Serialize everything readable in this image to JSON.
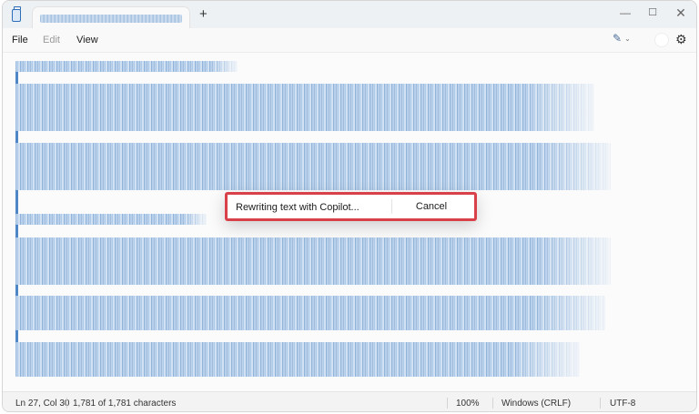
{
  "menu": {
    "file": "File",
    "edit": "Edit",
    "view": "View"
  },
  "titlebar": {
    "new_tab": "+",
    "minimize": "—",
    "maximize": "☐",
    "close": "✕"
  },
  "toolbar": {
    "copilot_icon": "✎",
    "copilot_chevron": "⌄",
    "settings_icon": "⚙"
  },
  "dialog": {
    "status": "Rewriting text with Copilot...",
    "cancel": "Cancel"
  },
  "status": {
    "position": "Ln 27, Col 30",
    "characters": "1,781 of 1,781 characters",
    "zoom": "100%",
    "line_ending": "Windows (CRLF)",
    "encoding": "UTF-8"
  },
  "colors": {
    "accent": "#2f6fba",
    "dialog_border": "#d9414a",
    "selection": "#aecaea"
  }
}
